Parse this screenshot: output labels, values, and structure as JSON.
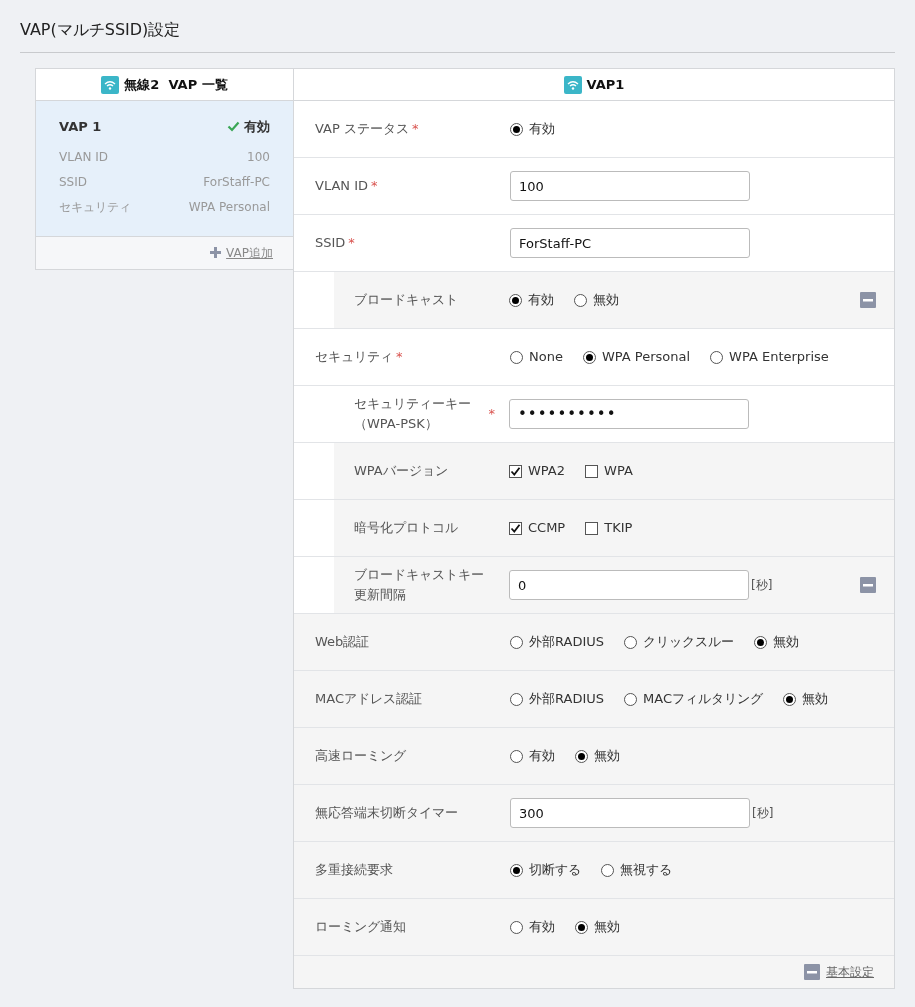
{
  "page_title": "VAP(マルチSSID)設定",
  "vap_list": {
    "title": "無線2  VAP 一覧",
    "items": [
      {
        "name": "VAP 1",
        "status": "有効",
        "enabled": true,
        "selected": true,
        "details": [
          {
            "key": "VLAN ID",
            "value": "100"
          },
          {
            "key": "SSID",
            "value": "ForStaff-PC"
          },
          {
            "key": "セキュリティ",
            "value": "WPA Personal"
          }
        ]
      }
    ],
    "add_link": "VAP追加"
  },
  "form": {
    "title": "VAP1",
    "sections": [
      {
        "kind": "basic",
        "rows": [
          {
            "kind": "radio",
            "label_lines": [
              "VAP ステータス"
            ],
            "required_mark": "*",
            "options": [
              {
                "label": "有効",
                "selected": true
              }
            ]
          },
          {
            "kind": "text",
            "label_lines": [
              "VLAN ID"
            ],
            "required_mark": "*",
            "value": "100"
          },
          {
            "kind": "text",
            "label_lines": [
              "SSID"
            ],
            "required_mark": "*",
            "value": "ForStaff-PC",
            "children": [
              {
                "kind": "radio",
                "label_lines": [
                  "ブロードキャスト"
                ],
                "collapse": true,
                "options": [
                  {
                    "label": "有効",
                    "selected": true
                  },
                  {
                    "label": "無効",
                    "selected": false
                  }
                ]
              }
            ]
          },
          {
            "kind": "radio",
            "label_lines": [
              "セキュリティ"
            ],
            "required_mark": "*",
            "options": [
              {
                "label": "None",
                "selected": false
              },
              {
                "label": "WPA Personal",
                "selected": true
              },
              {
                "label": "WPA Enterprise",
                "selected": false
              }
            ],
            "children": [
              {
                "kind": "password",
                "label_lines": [
                  "セキュリティーキー",
                  "（WPA-PSK）"
                ],
                "required_mark": "*",
                "collapse": false,
                "value": "••••••••••"
              },
              {
                "kind": "checkbox",
                "label_lines": [
                  "WPAバージョン"
                ],
                "collapse": false,
                "options": [
                  {
                    "label": "WPA2",
                    "checked": true
                  },
                  {
                    "label": "WPA",
                    "checked": false
                  }
                ]
              },
              {
                "kind": "checkbox",
                "label_lines": [
                  "暗号化プロトコル"
                ],
                "collapse": false,
                "options": [
                  {
                    "label": "CCMP",
                    "checked": true
                  },
                  {
                    "label": "TKIP",
                    "checked": false
                  }
                ]
              },
              {
                "kind": "text",
                "label_lines": [
                  "ブロードキャストキー",
                  "更新間隔"
                ],
                "collapse": true,
                "value": "0",
                "unit": "[秒]"
              }
            ]
          }
        ]
      },
      {
        "kind": "advanced",
        "rows": [
          {
            "kind": "radio",
            "label_lines": [
              "Web認証"
            ],
            "options": [
              {
                "label": "外部RADIUS",
                "selected": false
              },
              {
                "label": "クリックスルー",
                "selected": false
              },
              {
                "label": "無効",
                "selected": true
              }
            ]
          },
          {
            "kind": "radio",
            "label_lines": [
              "MACアドレス認証"
            ],
            "options": [
              {
                "label": "外部RADIUS",
                "selected": false
              },
              {
                "label": "MACフィルタリング",
                "selected": false
              },
              {
                "label": "無効",
                "selected": true
              }
            ]
          },
          {
            "kind": "radio",
            "label_lines": [
              "高速ローミング"
            ],
            "options": [
              {
                "label": "有効",
                "selected": false
              },
              {
                "label": "無効",
                "selected": true
              }
            ]
          },
          {
            "kind": "text",
            "label_lines": [
              "無応答端末切断タイマー"
            ],
            "value": "300",
            "unit": "[秒]"
          },
          {
            "kind": "radio",
            "label_lines": [
              "多重接続要求"
            ],
            "options": [
              {
                "label": "切断する",
                "selected": true
              },
              {
                "label": "無視する",
                "selected": false
              }
            ]
          },
          {
            "kind": "radio",
            "label_lines": [
              "ローミング通知"
            ],
            "options": [
              {
                "label": "有効",
                "selected": false
              },
              {
                "label": "無効",
                "selected": true
              }
            ]
          }
        ]
      }
    ],
    "footer_link": "基本設定"
  }
}
